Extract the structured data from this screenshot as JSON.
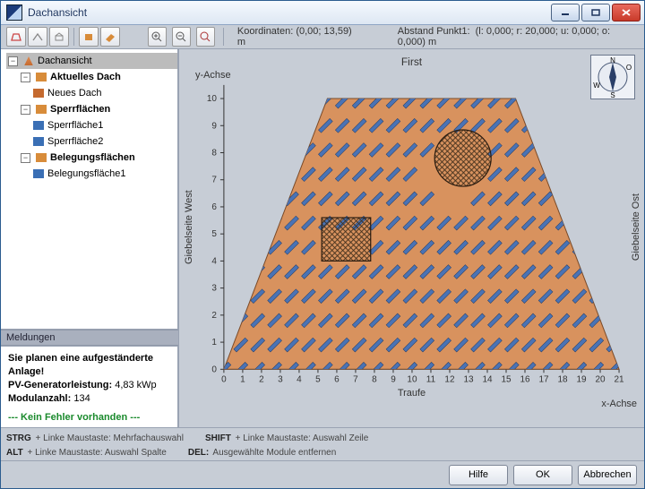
{
  "window": {
    "title": "Dachansicht"
  },
  "toolbar": {
    "coords_label": "Koordinaten:",
    "coords_value": "(0,00; 13,59) m",
    "abstand_label": "Abstand Punkt1:",
    "abstand_value": "(l: 0,000; r: 20,000; u: 0,000; o: 0,000) m"
  },
  "tree": {
    "root": "Dachansicht",
    "n1": "Aktuelles Dach",
    "n1a": "Neues Dach",
    "n2": "Sperrflächen",
    "n2a": "Sperrfläche1",
    "n2b": "Sperrfläche2",
    "n3": "Belegungsflächen",
    "n3a": "Belegungsfläche1"
  },
  "messages": {
    "title": "Meldungen",
    "line1": "Sie planen eine aufgeständerte Anlage!",
    "line2_label": "PV-Generatorleistung:",
    "line2_value": "4,83 kWp",
    "line3_label": "Modulanzahl:",
    "line3_value": "134",
    "ok_line": "--- Kein Fehler vorhanden ---"
  },
  "hints": {
    "h1a": "STRG",
    "h1b": " + Linke Maustaste:  Mehrfachauswahl",
    "h2a": "ALT",
    "h2b": " + Linke Maustaste:  Auswahl Spalte",
    "h3a": "SHIFT",
    "h3b": " + Linke Maustaste:  Auswahl Zeile",
    "h4a": "DEL:",
    "h4b": " Ausgewählte Module entfernen"
  },
  "buttons": {
    "help": "Hilfe",
    "ok": "OK",
    "cancel": "Abbrechen"
  },
  "compass": {
    "n": "N",
    "s": "S",
    "e": "O",
    "w": "W"
  },
  "chart_data": {
    "type": "area",
    "title": "First",
    "xlabel": "Traufe",
    "ylabel": "y-Achse",
    "x2label": "x-Achse",
    "left_label": "Giebelseite West",
    "right_label": "Giebelseite Ost",
    "xlim": [
      0,
      21
    ],
    "ylim": [
      0,
      10.5
    ],
    "xticks": [
      0,
      1,
      2,
      3,
      4,
      5,
      6,
      7,
      8,
      9,
      10,
      11,
      12,
      13,
      14,
      15,
      16,
      17,
      18,
      19,
      20,
      21
    ],
    "yticks": [
      0,
      1,
      2,
      3,
      4,
      5,
      6,
      7,
      8,
      9,
      10
    ],
    "roof_polygon": [
      [
        0,
        0
      ],
      [
        21,
        0
      ],
      [
        15.5,
        10
      ],
      [
        5.5,
        10
      ]
    ],
    "blocked_rect": {
      "x": 5.2,
      "y": 4.0,
      "w": 2.6,
      "h": 1.6
    },
    "blocked_circle": {
      "cx": 12.7,
      "cy": 7.8,
      "r": 1.5
    },
    "module_angle_deg": 45,
    "module_count": 134,
    "columns": 13,
    "rows_per_column_approx": 10
  }
}
